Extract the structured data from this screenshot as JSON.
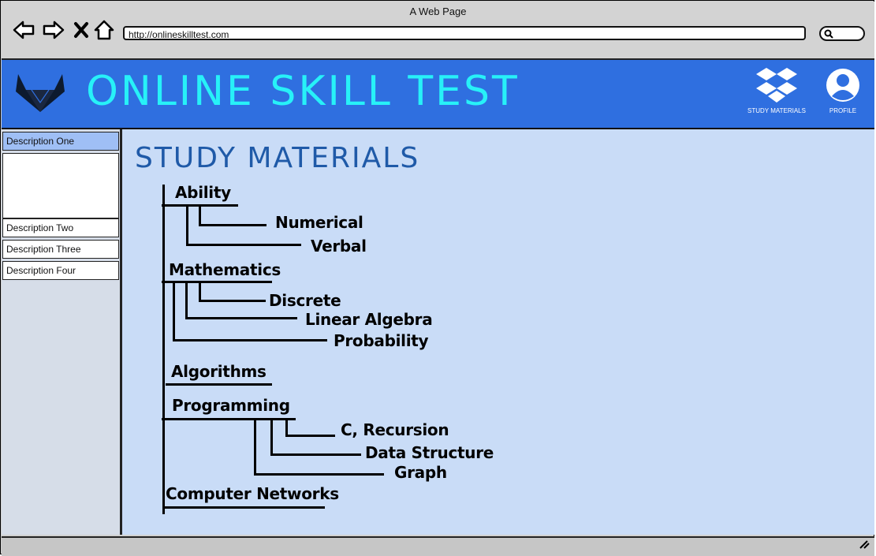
{
  "window": {
    "title": "A Web Page",
    "url": "http://onlineskilltest.com"
  },
  "header": {
    "title": "ONLINE SKILL TEST",
    "actions": [
      {
        "label": "STUDY MATERIALS",
        "icon": "dropbox-icon"
      },
      {
        "label": "PROFILE",
        "icon": "user-icon"
      }
    ]
  },
  "sidebar": {
    "items": [
      {
        "label": "Description One"
      },
      {
        "label": "Description Two"
      },
      {
        "label": "Description Three"
      },
      {
        "label": "Description Four"
      }
    ]
  },
  "main": {
    "title": "STUDY MATERIALS",
    "topics": [
      {
        "label": "Ability",
        "subtopics": [
          "Numerical",
          "Verbal"
        ]
      },
      {
        "label": "Mathematics",
        "subtopics": [
          "Discrete",
          "Linear Algebra",
          "Probability"
        ]
      },
      {
        "label": "Algorithms",
        "subtopics": []
      },
      {
        "label": "Programming",
        "subtopics": [
          "C, Recursion",
          "Data Structure",
          "Graph"
        ]
      },
      {
        "label": "Computer Networks",
        "subtopics": []
      }
    ]
  },
  "colors": {
    "header": "#2f6fe0",
    "title": "#27f1f8",
    "content": "#c9dcf7",
    "heading": "#1f5aa8",
    "active_item": "#9fbff5"
  }
}
